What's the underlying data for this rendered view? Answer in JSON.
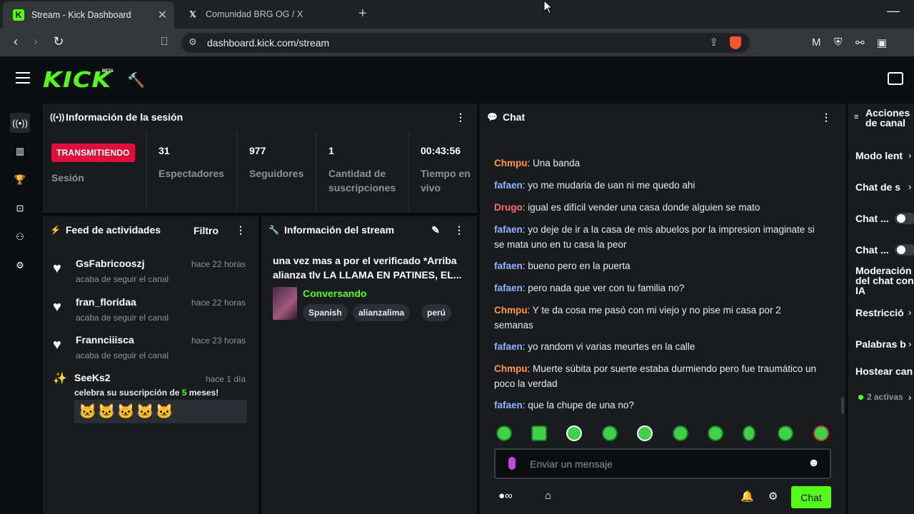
{
  "browser": {
    "tabs": [
      {
        "title": "Stream - Kick Dashboard",
        "active": true
      },
      {
        "title": "Comunidad BRG OG / X",
        "active": false
      }
    ],
    "url": "dashboard.kick.com/stream"
  },
  "header": {
    "logo": "KICK",
    "beta": "BETA"
  },
  "session": {
    "title": "Información de la sesión",
    "live_badge": "TRANSMITIENDO",
    "session_label": "Sesión",
    "stats": [
      {
        "value": "31",
        "label": "Espectadores"
      },
      {
        "value": "977",
        "label": "Seguidores"
      },
      {
        "value": "1",
        "label": "Cantidad de suscripciones"
      },
      {
        "value": "00:43:56",
        "label": "Tiempo en vivo"
      }
    ]
  },
  "feed": {
    "title": "Feed de actividades",
    "filter": "Filtro",
    "items": [
      {
        "name": "GsFabricooszj",
        "time": "hace 22 horas",
        "text": "acaba de seguir el canal"
      },
      {
        "name": "fran_floridaa",
        "time": "hace 22 horas",
        "text": "acaba de seguir el canal"
      },
      {
        "name": "Frannciiisca",
        "time": "hace 23 horas",
        "text": "acaba de seguir el canal"
      }
    ],
    "sub": {
      "name": "SeeKs2",
      "time": "hace 1 día",
      "text_pre": "celebra su suscripción de ",
      "months": "5",
      "text_post": " meses!"
    }
  },
  "stream_info": {
    "title": "Información del stream",
    "stream_title": "una vez mas a por el verificado *Arriba alianza tlv LA LLAMA EN PATINES, EL...",
    "category": "Conversando",
    "tags": [
      "Spanish",
      "alianzalima",
      "perú"
    ]
  },
  "chat": {
    "title": "Chat",
    "messages": [
      {
        "user": "Chmpu",
        "color": "#ff9a2e",
        "text": "Una banda"
      },
      {
        "user": "fafaen",
        "color": "#8fb4ff",
        "text": "yo me mudaria de uan ni me quedo ahi"
      },
      {
        "user": "Drugo",
        "color": "#ff6b6b",
        "text": "igual es difícil vender una casa donde alguien se mato"
      },
      {
        "user": "fafaen",
        "color": "#8fb4ff",
        "text": "yo deje de ir a la casa de mis abuelos por la impresion imaginate si se mata uno en tu casa la peor"
      },
      {
        "user": "fafaen",
        "color": "#8fb4ff",
        "text": "bueno pero en la puerta"
      },
      {
        "user": "fafaen",
        "color": "#8fb4ff",
        "text": "pero nada que ver con tu familia no?"
      },
      {
        "user": "Chmpu",
        "color": "#ff9a2e",
        "text": "Y te da cosa me pasó con mi viejo y no pise mi casa por 2 semanas"
      },
      {
        "user": "fafaen",
        "color": "#8fb4ff",
        "text": "yo random vi varias meurtes en la calle"
      },
      {
        "user": "Chmpu",
        "color": "#ff9a2e",
        "text": "Muerte súbita por suerte estaba durmiendo pero fue traumático un poco la verdad"
      },
      {
        "user": "fafaen",
        "color": "#8fb4ff",
        "text": "que la chupe de una no?"
      }
    ],
    "input_placeholder": "Enviar un mensaje",
    "send_label": "Chat"
  },
  "actions": {
    "title": "Acciones de canal",
    "items": [
      "Modo lent",
      "Chat de s",
      "Chat ...",
      "Chat ...",
      "Moderación del chat con IA",
      "Restricció",
      "Palabras b",
      "Hostear can"
    ],
    "active_count": "2 activas"
  },
  "colors": {
    "accent": "#53fc18",
    "live": "#e0103d"
  }
}
